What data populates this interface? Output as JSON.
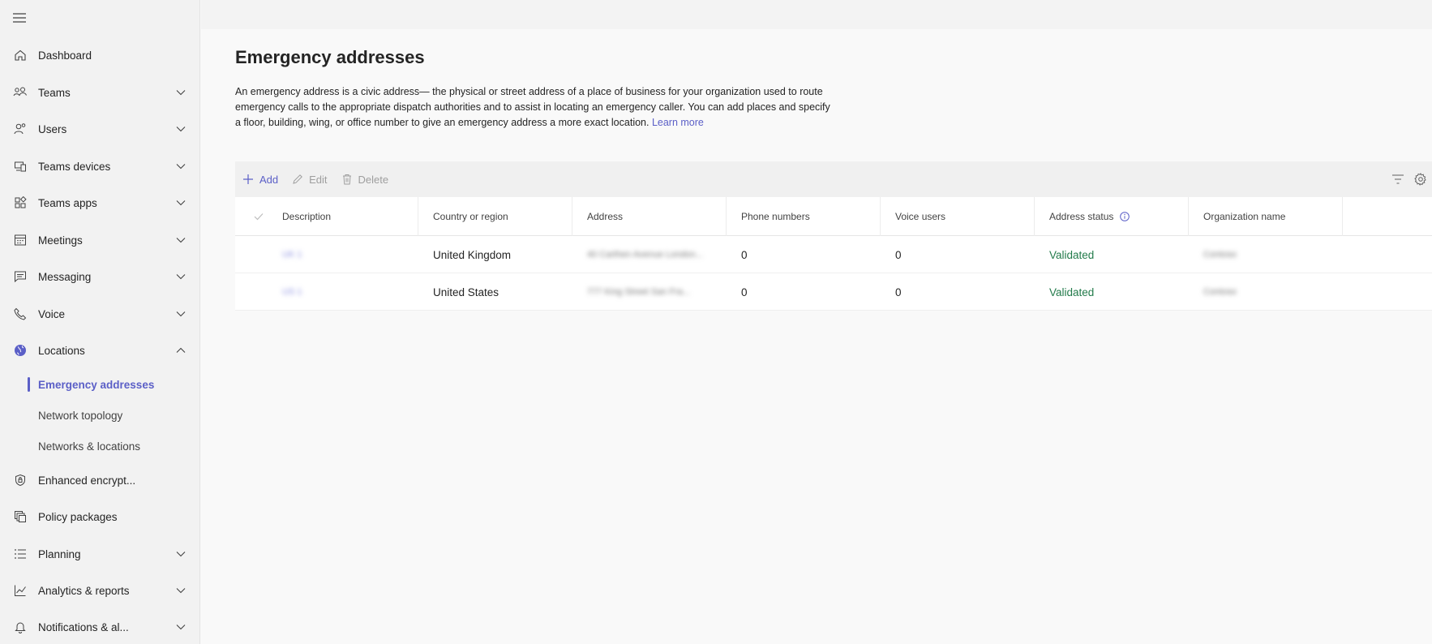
{
  "sidebar": {
    "items": [
      {
        "label": "Dashboard",
        "icon": "home-icon",
        "expandable": false
      },
      {
        "label": "Teams",
        "icon": "teams-icon",
        "expandable": true
      },
      {
        "label": "Users",
        "icon": "users-icon",
        "expandable": true
      },
      {
        "label": "Teams devices",
        "icon": "devices-icon",
        "expandable": true
      },
      {
        "label": "Teams apps",
        "icon": "apps-icon",
        "expandable": true
      },
      {
        "label": "Meetings",
        "icon": "calendar-icon",
        "expandable": true
      },
      {
        "label": "Messaging",
        "icon": "chat-icon",
        "expandable": true
      },
      {
        "label": "Voice",
        "icon": "phone-icon",
        "expandable": true
      },
      {
        "label": "Locations",
        "icon": "globe-icon",
        "expandable": true,
        "expanded": true
      },
      {
        "label": "Enhanced encrypt...",
        "icon": "shield-icon",
        "expandable": false
      },
      {
        "label": "Policy packages",
        "icon": "package-icon",
        "expandable": false
      },
      {
        "label": "Planning",
        "icon": "list-icon",
        "expandable": true
      },
      {
        "label": "Analytics & reports",
        "icon": "chart-icon",
        "expandable": true
      },
      {
        "label": "Notifications & al...",
        "icon": "bell-icon",
        "expandable": true
      }
    ],
    "locations_sub": [
      {
        "label": "Emergency addresses",
        "active": true
      },
      {
        "label": "Network topology",
        "active": false
      },
      {
        "label": "Networks & locations",
        "active": false
      }
    ]
  },
  "page": {
    "title": "Emergency addresses",
    "description": "An emergency address is a civic address— the physical or street address of a place of business for your organization used to route emergency calls to the appropriate dispatch authorities and to assist in locating an emergency caller. You can add places and specify a floor, building, wing, or office number to give an emergency address a more exact location.",
    "learn_more": "Learn more"
  },
  "toolbar": {
    "add_label": "Add",
    "edit_label": "Edit",
    "delete_label": "Delete"
  },
  "table": {
    "columns": [
      "Description",
      "Country or region",
      "Address",
      "Phone numbers",
      "Voice users",
      "Address status",
      "Organization name"
    ],
    "rows": [
      {
        "description": "UK 1",
        "country": "United Kingdom",
        "address": "40 Carthen Avenue London...",
        "phone_numbers": "0",
        "voice_users": "0",
        "status": "Validated",
        "organization": "Contoso"
      },
      {
        "description": "US 1",
        "country": "United States",
        "address": "777 King Street San Fra...",
        "phone_numbers": "0",
        "voice_users": "0",
        "status": "Validated",
        "organization": "Contoso"
      }
    ]
  },
  "colors": {
    "accent": "#5b5fc7",
    "validated": "#237b4b"
  }
}
